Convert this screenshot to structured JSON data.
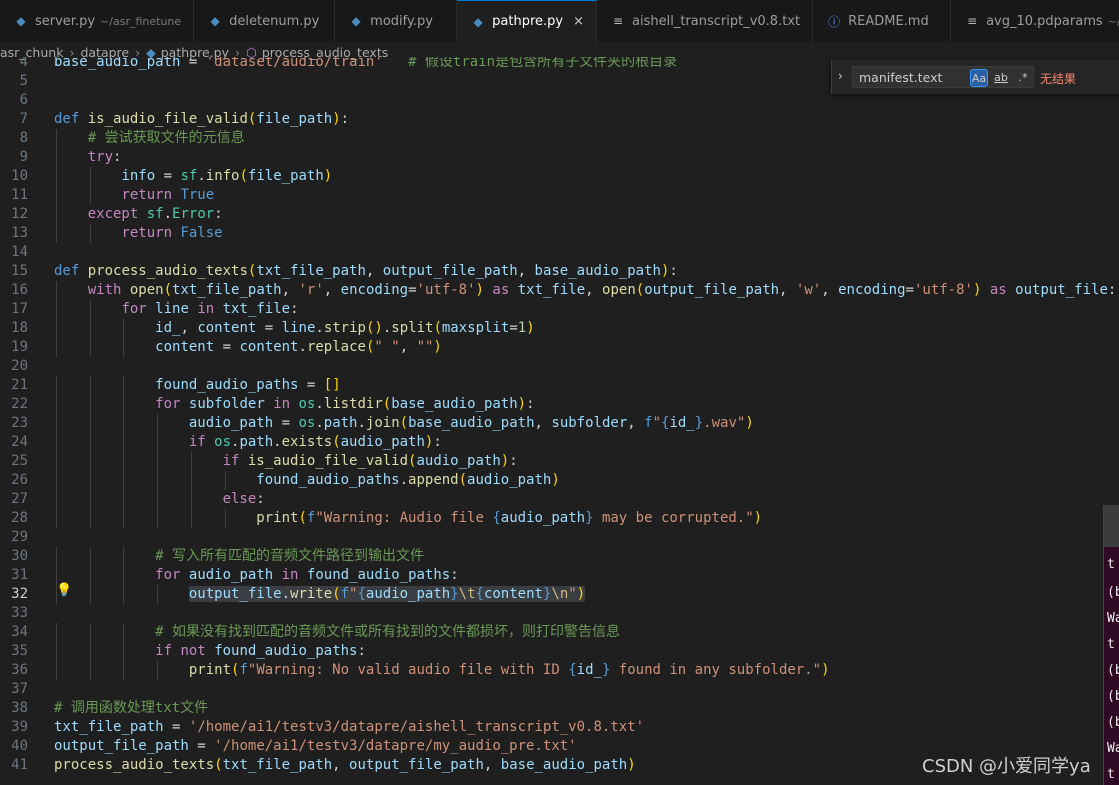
{
  "tabs": [
    {
      "label": "server.py",
      "subtitle": "~/asr_finetune",
      "icon": "python-icon",
      "active": false
    },
    {
      "label": "deletenum.py",
      "subtitle": "",
      "icon": "python-icon",
      "active": false
    },
    {
      "label": "modify.py",
      "subtitle": "",
      "icon": "python-icon",
      "active": false
    },
    {
      "label": "pathpre.py",
      "subtitle": "",
      "icon": "python-icon",
      "active": true,
      "close": "×"
    },
    {
      "label": "aishell_transcript_v0.8.txt",
      "subtitle": "",
      "icon": "text-file-icon",
      "active": false
    },
    {
      "label": "README.md",
      "subtitle": "",
      "icon": "info-icon",
      "active": false
    },
    {
      "label": "avg_10.pdparams",
      "subtitle": "~/…/chunk",
      "icon": "text-file-icon",
      "active": false
    }
  ],
  "breadcrumb": {
    "items": [
      "asr_chunk",
      "datapre",
      "pathpre.py",
      "process_audio_texts"
    ]
  },
  "find_widget": {
    "query": "manifest.text",
    "match_case": "Aa",
    "match_word": "ab",
    "regex": ".*",
    "result": "无结果"
  },
  "editor": {
    "current_line": 32
  },
  "code_lines": [
    {
      "n": "4",
      "t": "base_audio_path = 'dataset/audio/train'   # 假设train是包含所有子文件夹的根目录"
    },
    {
      "n": "5",
      "t": ""
    },
    {
      "n": "6",
      "t": ""
    },
    {
      "n": "7",
      "t": "def is_audio_file_valid(file_path):"
    },
    {
      "n": "8",
      "t": "    # 尝试获取文件的元信息"
    },
    {
      "n": "9",
      "t": "    try:"
    },
    {
      "n": "10",
      "t": "        info = sf.info(file_path)"
    },
    {
      "n": "11",
      "t": "        return True"
    },
    {
      "n": "12",
      "t": "    except sf.Error:"
    },
    {
      "n": "13",
      "t": "        return False"
    },
    {
      "n": "14",
      "t": ""
    },
    {
      "n": "15",
      "t": "def process_audio_texts(txt_file_path, output_file_path, base_audio_path):"
    },
    {
      "n": "16",
      "t": "    with open(txt_file_path, 'r', encoding='utf-8') as txt_file, open(output_file_path, 'w', encoding='utf-8') as output_file:"
    },
    {
      "n": "17",
      "t": "        for line in txt_file:"
    },
    {
      "n": "18",
      "t": "            id_, content = line.strip().split(maxsplit=1)"
    },
    {
      "n": "19",
      "t": "            content = content.replace(\" \", \"\")"
    },
    {
      "n": "20",
      "t": ""
    },
    {
      "n": "21",
      "t": "            found_audio_paths = []"
    },
    {
      "n": "22",
      "t": "            for subfolder in os.listdir(base_audio_path):"
    },
    {
      "n": "23",
      "t": "                audio_path = os.path.join(base_audio_path, subfolder, f\"{id_}.wav\")"
    },
    {
      "n": "24",
      "t": "                if os.path.exists(audio_path):"
    },
    {
      "n": "25",
      "t": "                    if is_audio_file_valid(audio_path):"
    },
    {
      "n": "26",
      "t": "                        found_audio_paths.append(audio_path)"
    },
    {
      "n": "27",
      "t": "                    else:"
    },
    {
      "n": "28",
      "t": "                        print(f\"Warning: Audio file {audio_path} may be corrupted.\")"
    },
    {
      "n": "29",
      "t": ""
    },
    {
      "n": "30",
      "t": "            # 写入所有匹配的音频文件路径到输出文件"
    },
    {
      "n": "31",
      "t": "            for audio_path in found_audio_paths:"
    },
    {
      "n": "32",
      "t": "                output_file.write(f\"{audio_path}\\t{content}\\n\")"
    },
    {
      "n": "33",
      "t": ""
    },
    {
      "n": "34",
      "t": "            # 如果没有找到匹配的音频文件或所有找到的文件都损坏，则打印警告信息"
    },
    {
      "n": "35",
      "t": "            if not found_audio_paths:"
    },
    {
      "n": "36",
      "t": "                print(f\"Warning: No valid audio file with ID {id_} found in any subfolder.\")"
    },
    {
      "n": "37",
      "t": ""
    },
    {
      "n": "38",
      "t": "# 调用函数处理txt文件"
    },
    {
      "n": "39",
      "t": "txt_file_path = '/home/ai1/testv3/datapre/aishell_transcript_v0.8.txt'"
    },
    {
      "n": "40",
      "t": "output_file_path = '/home/ai1/testv3/datapre/my_audio_pre.txt'"
    },
    {
      "n": "41",
      "t": "process_audio_texts(txt_file_path, output_file_path, base_audio_path)"
    }
  ],
  "terminal_peek": [
    "t",
    "(b",
    "Wa",
    "t",
    "(b",
    "(b",
    "(b",
    "Wa",
    "t"
  ],
  "watermark": "CSDN @小爱同学ya"
}
